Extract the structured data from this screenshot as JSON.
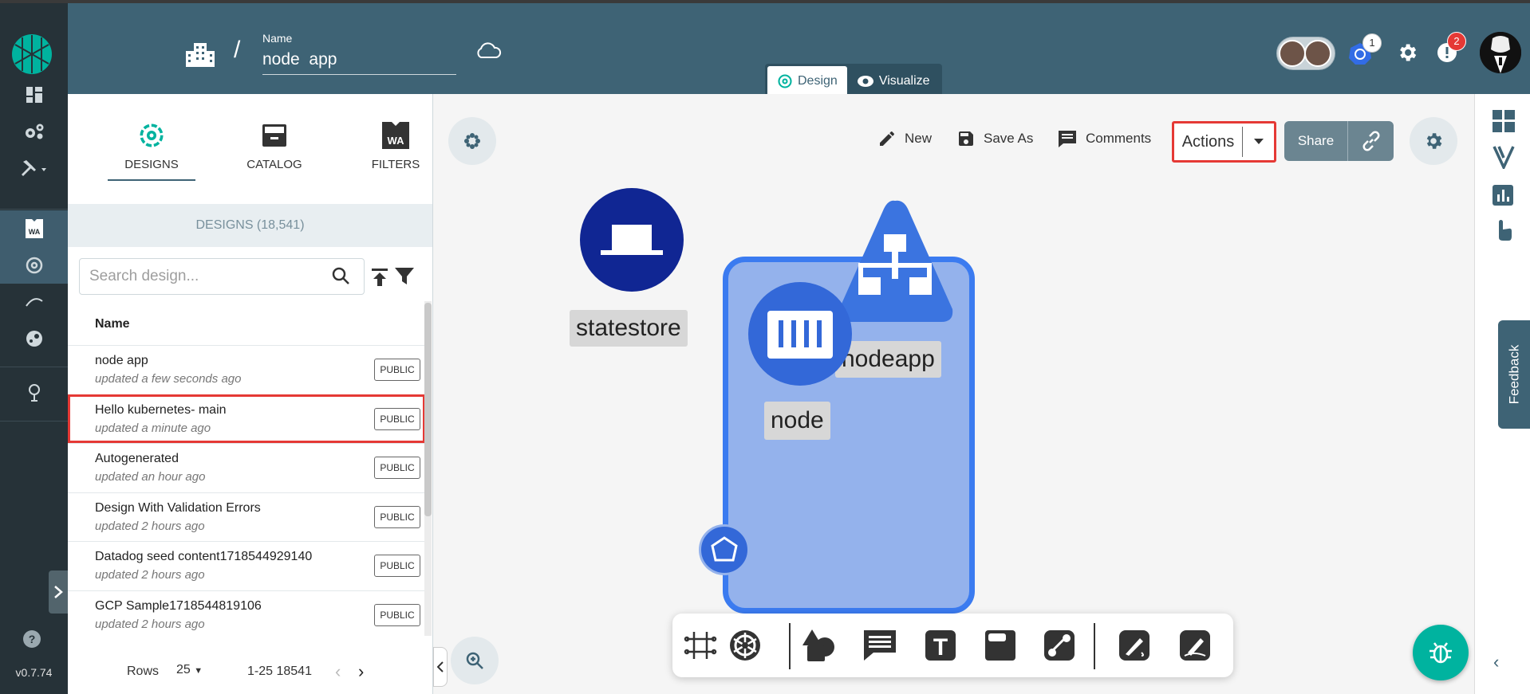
{
  "header": {
    "name_label": "Name",
    "design_name": "node  app",
    "tabs": [
      {
        "label": "Design",
        "active": true
      },
      {
        "label": "Visualize",
        "active": false
      }
    ],
    "k8s_badge": "1",
    "alert_badge": "2"
  },
  "sidebar": {
    "version": "v0.7.74",
    "items": [
      "dashboard-icon",
      "configuration-icon",
      "lifecycle-icon",
      "catalog-wa-icon",
      "meshery-design-icon",
      "performance-icon",
      "extensions-icon",
      "location-icon"
    ]
  },
  "panel": {
    "tabs": [
      {
        "label": "DESIGNS",
        "active": true
      },
      {
        "label": "CATALOG",
        "active": false
      },
      {
        "label": "FILTERS",
        "active": false
      }
    ],
    "count_label": "DESIGNS (18,541)",
    "search_placeholder": "Search design...",
    "column_header": "Name",
    "rows": [
      {
        "title": "node app",
        "updated": "updated a few seconds ago",
        "visibility": "PUBLIC"
      },
      {
        "title": "Hello kubernetes- main",
        "updated": "updated a minute ago",
        "visibility": "PUBLIC"
      },
      {
        "title": "Autogenerated",
        "updated": "updated an hour ago",
        "visibility": "PUBLIC"
      },
      {
        "title": "Design With Validation Errors",
        "updated": "updated 2 hours ago",
        "visibility": "PUBLIC"
      },
      {
        "title": "Datadog seed content1718544929140",
        "updated": "updated 2 hours ago",
        "visibility": "PUBLIC"
      },
      {
        "title": "GCP Sample1718544819106",
        "updated": "updated 2 hours ago",
        "visibility": "PUBLIC"
      }
    ],
    "pager": {
      "rows_label": "Rows",
      "rows_per_page": "25",
      "range": "1-25 18541"
    }
  },
  "canvas": {
    "toolbar": {
      "new_label": "New",
      "save_as_label": "Save As",
      "comments_label": "Comments",
      "actions_label": "Actions",
      "share_label": "Share"
    },
    "nodes": {
      "statestore": "statestore",
      "nodeapp": "nodeapp",
      "node": "node"
    }
  },
  "right_strip": {
    "feedback_label": "Feedback"
  },
  "colors": {
    "header": "#3e6375",
    "rail": "#263238",
    "accent": "#00b39f",
    "highlight": "#e53935",
    "node_blue": "#3367d6",
    "statestore_blue": "#102693"
  }
}
